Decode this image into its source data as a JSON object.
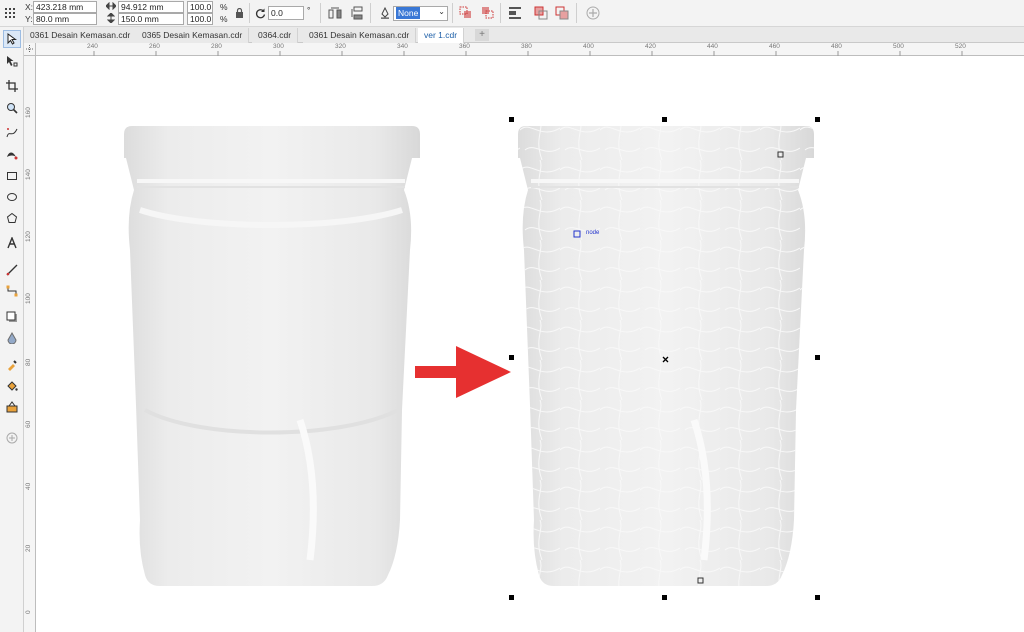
{
  "property_bar": {
    "x_label": "X:",
    "x_value": "423.218 mm",
    "y_label": "Y:",
    "y_value": "80.0 mm",
    "width_value": "94.912 mm",
    "height_value": "150.0 mm",
    "scale_x": "100.0",
    "scale_y": "100.0",
    "percent": "%",
    "rotation_value": "0.0",
    "degree": "°",
    "outline_value": "None"
  },
  "tabs": [
    {
      "label": "0361 Desain Kemasan.cdr"
    },
    {
      "label": "0365 Desain Kemasan.cdr"
    },
    {
      "label": "0364.cdr"
    },
    {
      "label": "0361 Desain Kemasan.cdr"
    },
    {
      "label": "ver 1.cdr"
    }
  ],
  "tab_add": "+",
  "ruler_h": [
    "240",
    "260",
    "280",
    "300",
    "320",
    "340",
    "360",
    "380",
    "400",
    "420",
    "440",
    "460",
    "480",
    "500",
    "520"
  ],
  "ruler_v": [
    "160",
    "140",
    "120",
    "100",
    "80",
    "60",
    "40",
    "20",
    "0"
  ],
  "canvas": {
    "node_label": "node"
  },
  "colors": {
    "arrow": "#e63030",
    "tab_active_text": "#1d5fa8",
    "outline_dropdown": "#3a78d6"
  }
}
